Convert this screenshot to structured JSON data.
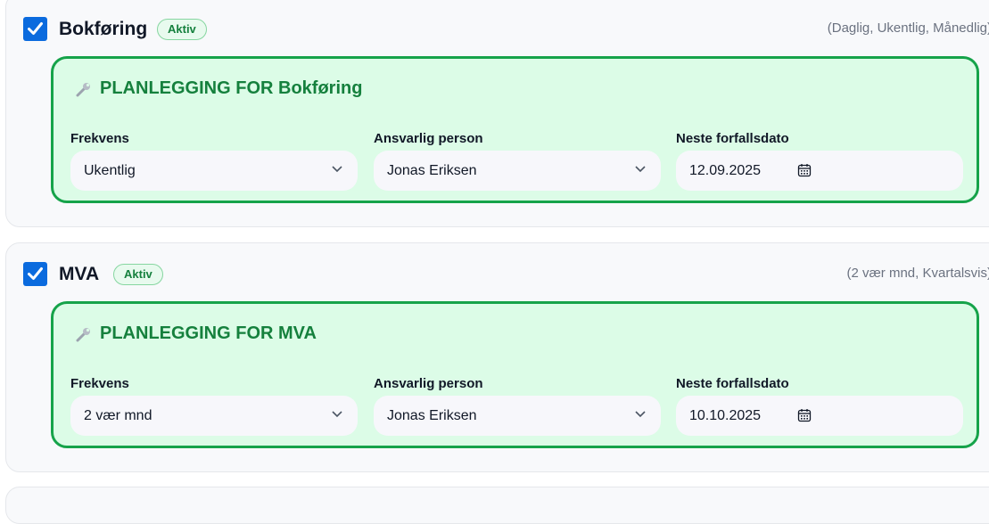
{
  "sections": [
    {
      "title": "Bokføring",
      "badge": "Aktiv",
      "frequency_hint": "(Daglig, Ukentlig, Månedlig)",
      "panel_title": "PLANLEGGING FOR Bokføring",
      "fields": {
        "frequency_label": "Frekvens",
        "frequency_value": "Ukentlig",
        "person_label": "Ansvarlig person",
        "person_value": "Jonas Eriksen",
        "date_label": "Neste forfallsdato",
        "date_value": "12.09.2025"
      },
      "checked": true
    },
    {
      "title": "MVA",
      "badge": "Aktiv",
      "frequency_hint": "(2 vær mnd, Kvartalsvis)",
      "panel_title": "PLANLEGGING FOR MVA",
      "fields": {
        "frequency_label": "Frekvens",
        "frequency_value": "2 vær mnd",
        "person_label": "Ansvarlig person",
        "person_value": "Jonas Eriksen",
        "date_label": "Neste forfallsdato",
        "date_value": "10.10.2025"
      },
      "checked": true
    }
  ],
  "colors": {
    "checkbox": "#0b6bde",
    "panel_border": "#16a34a",
    "panel_bg": "#dcfce7",
    "accent_text": "#15803d"
  },
  "icons": [
    "checkmark-icon",
    "wrench-icon",
    "chevron-down-icon",
    "calendar-icon"
  ]
}
